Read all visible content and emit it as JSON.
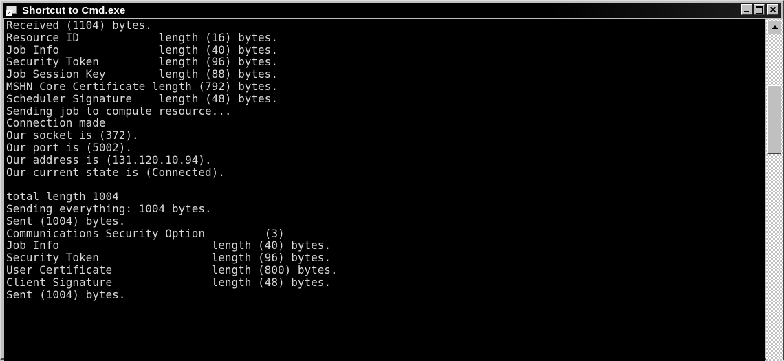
{
  "window": {
    "title": "Shortcut to Cmd.exe",
    "icon": "cmd-shortcut-icon"
  },
  "console": {
    "lines": [
      "Received (1104) bytes.",
      "Resource ID            length (16) bytes.",
      "Job Info               length (40) bytes.",
      "Security Token         length (96) bytes.",
      "Job Session Key        length (88) bytes.",
      "MSHN Core Certificate length (792) bytes.",
      "Scheduler Signature    length (48) bytes.",
      "Sending job to compute resource...",
      "Connection made",
      "Our socket is (372).",
      "Our port is (5002).",
      "Our address is (131.120.10.94).",
      "Our current state is (Connected).",
      "",
      "total length 1004",
      "Sending everything: 1004 bytes.",
      "Sent (1004) bytes.",
      "Communications Security Option         (3)",
      "Job Info                       length (40) bytes.",
      "Security Token                 length (96) bytes.",
      "User Certificate               length (800) bytes.",
      "Client Signature               length (48) bytes.",
      "Sent (1004) bytes."
    ]
  },
  "colors": {
    "console_bg": "#000000",
    "console_fg": "#d8d8d8",
    "titlebar_bg": "#000000"
  }
}
